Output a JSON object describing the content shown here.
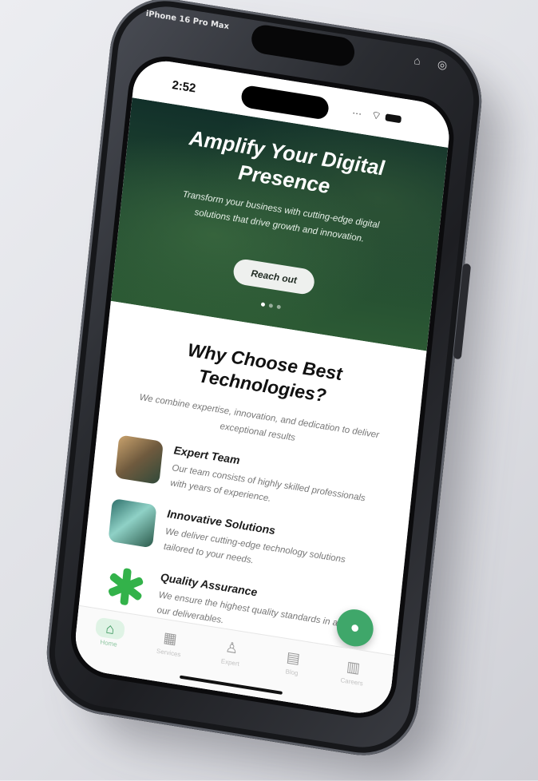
{
  "device": {
    "label": "iPhone 16 Pro Max"
  },
  "status_bar": {
    "time": "2:52"
  },
  "hero": {
    "title": "Amplify Your Digital Presence",
    "description": "Transform your business with cutting-edge digital solutions that drive growth and innovation.",
    "cta_label": "Reach out",
    "slide_count": 3,
    "active_slide": 1
  },
  "why": {
    "title": "Why Choose Best Technologies?",
    "subtitle": "We combine expertise, innovation, and dedication to deliver exceptional results"
  },
  "features": [
    {
      "title": "Expert Team",
      "description": "Our team consists of highly skilled professionals with years of experience.",
      "icon": "team-photo"
    },
    {
      "title": "Innovative Solutions",
      "description": "We deliver cutting-edge technology solutions tailored to your needs.",
      "icon": "innovation-photo"
    },
    {
      "title": "Quality Assurance",
      "description": "We ensure the highest quality standards in all our deliverables.",
      "icon": "asterisk-badge-icon"
    }
  ],
  "tabbar": {
    "items": [
      {
        "label": "Home",
        "icon": "home-icon",
        "active": true
      },
      {
        "label": "Services",
        "icon": "grid-icon",
        "active": false
      },
      {
        "label": "Expert",
        "icon": "person-icon",
        "active": false
      },
      {
        "label": "Blog",
        "icon": "document-icon",
        "active": false
      },
      {
        "label": "Careers",
        "icon": "book-icon",
        "active": false
      }
    ]
  },
  "colors": {
    "accent": "#3fa76a",
    "hero_dark": "#12302a",
    "hero_light": "#2c5a34"
  }
}
